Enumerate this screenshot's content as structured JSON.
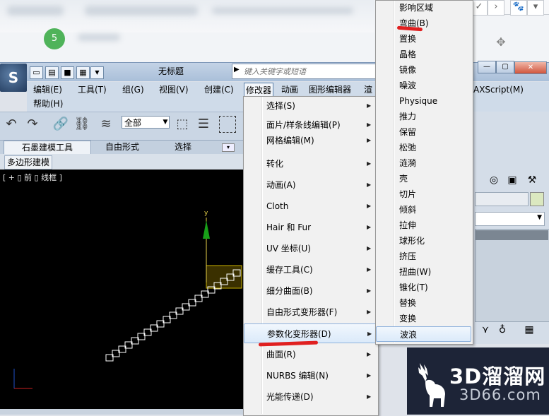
{
  "app": {
    "doc_title": "无标题",
    "search_placeholder": "键入关键字或短语",
    "quick_access_label": "▼"
  },
  "browser": {
    "badge_number": "5"
  },
  "menubar": {
    "items": [
      "编辑(E)",
      "工具(T)",
      "组(G)",
      "视图(V)",
      "创建(C)",
      "修改器",
      "动画",
      "图形编辑器",
      "渲",
      "AXScript(M)",
      "帮助(H)"
    ]
  },
  "toolbar": {
    "selection_filter": "全部"
  },
  "ribbon": {
    "tabs": [
      "石墨建模工具",
      "自由形式",
      "选择"
    ],
    "subtab": "多边形建模"
  },
  "viewport": {
    "label": "[ + ▯ 前 ▯ 线框 ]",
    "axis_y": "y"
  },
  "modifiers_menu": {
    "items": [
      "选择(S)",
      "面片/样条线编辑(P)",
      "网格编辑(M)",
      "转化",
      "动画(A)",
      "Cloth",
      "Hair 和 Fur",
      "UV 坐标(U)",
      "缓存工具(C)",
      "细分曲面(B)",
      "自由形式变形器(F)",
      "参数化变形器(D)",
      "曲面(R)",
      "NURBS 编辑(N)",
      "光能传递(D)"
    ],
    "highlighted": "参数化变形器(D)"
  },
  "parametric_submenu": {
    "items": [
      "影响区域",
      "弯曲(B)",
      "置换",
      "晶格",
      "镜像",
      "噪波",
      "Physique",
      "推力",
      "保留",
      "松弛",
      "涟漪",
      "壳",
      "切片",
      "倾斜",
      "拉伸",
      "球形化",
      "挤压",
      "扭曲(W)",
      "锥化(T)",
      "替换",
      "变换",
      "波浪"
    ],
    "highlighted": "波浪"
  },
  "watermark": {
    "main": "3D溜溜网",
    "sub": "3D66.com"
  },
  "colors": {
    "annotation_red": "#e02020",
    "menu_bg": "#f1f1f1",
    "viewport_bg": "#000000",
    "wireframe": "#ffffff",
    "selection_yellow": "#c8b000"
  }
}
